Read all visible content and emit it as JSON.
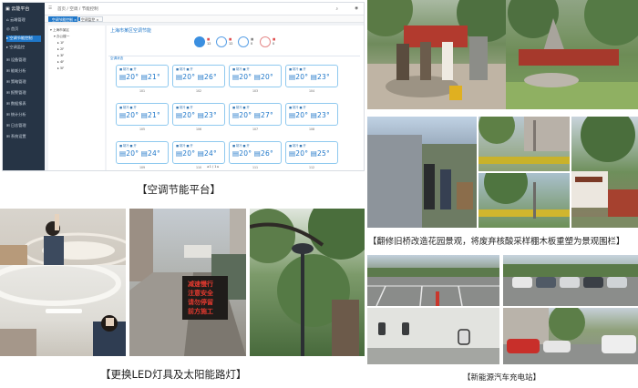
{
  "captions": {
    "platform": "【空调节能平台】",
    "garden": "【翻修旧桥改造花园景观，将废弃核酸采样棚木板重塑为景观围栏】",
    "lighting": "【更换LED灯具及太阳能路灯】",
    "charging": "【新能源汽车充电站】"
  },
  "sign_text": [
    "减速慢行",
    "注意安全",
    "请勿停留",
    "前方施工"
  ],
  "screenshot": {
    "cards": [
      {
        "head": "■ 制冷 ■ 开",
        "value": "▤20° ▤21°",
        "label": "101"
      },
      {
        "head": "■ 制冷 ■ 开",
        "value": "▤20° ▤26°",
        "label": "102"
      },
      {
        "head": "■ 制冷 ■ 开",
        "value": "▤20° ▤20°",
        "label": "103"
      },
      {
        "head": "■ 制冷 ■ 开",
        "value": "▤20° ▤23°",
        "label": "104"
      },
      {
        "head": "■ 制冷 ■ 开",
        "value": "▤20° ▤21°",
        "label": "105"
      },
      {
        "head": "■ 制冷 ■ 开",
        "value": "▤20° ▤23°",
        "label": "106"
      },
      {
        "head": "■ 制冷 ■ 开",
        "value": "▤20° ▤27°",
        "label": "107"
      },
      {
        "head": "■ 制冷 ■ 开",
        "value": "▤20° ▤23°",
        "label": "108"
      },
      {
        "head": "■ 制冷 ■ 开",
        "value": "▤20° ▤24°",
        "label": "109"
      },
      {
        "head": "■ 制冷 ■ 开",
        "value": "▤20° ▤24°",
        "label": "110"
      },
      {
        "head": "■ 制冷 ■ 开",
        "value": "▤20° ▤26°",
        "label": "111"
      },
      {
        "head": "■ 制冷 ■ 开",
        "value": "▤20° ▤25°",
        "label": "112"
      }
    ]
  }
}
